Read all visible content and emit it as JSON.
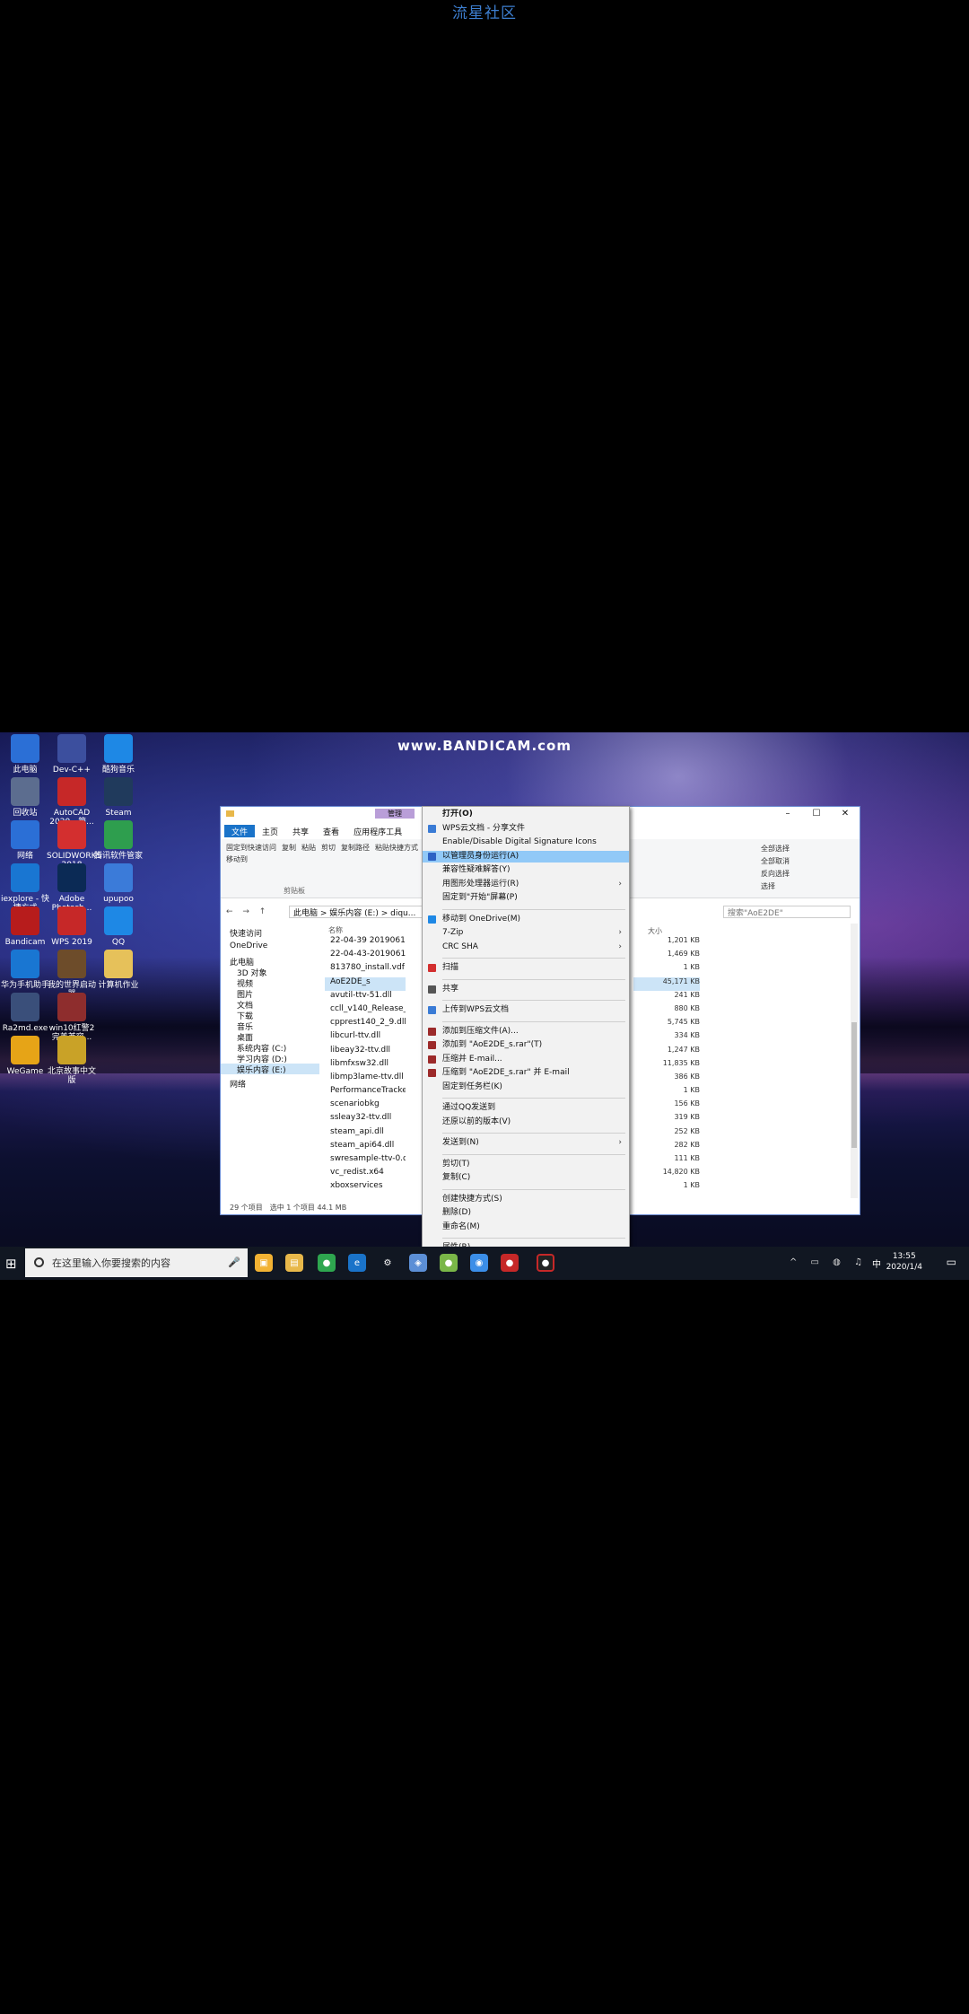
{
  "page_title": "流星社区",
  "watermark": "www.BANDICAM.com",
  "desktop_icons": [
    {
      "label": "此电脑",
      "color": "#2b6fd6"
    },
    {
      "label": "Dev-C++",
      "color": "#3c4f9e"
    },
    {
      "label": "酷狗音乐",
      "color": "#1e88e5"
    },
    {
      "label": "回收站",
      "color": "#5c6d8f"
    },
    {
      "label": "AutoCAD 2020 - 简...",
      "color": "#c62828"
    },
    {
      "label": "Steam",
      "color": "#203a5c"
    },
    {
      "label": "网络",
      "color": "#2b6fd6"
    },
    {
      "label": "SOLIDWORKS 2018",
      "color": "#d32f2f"
    },
    {
      "label": "腾讯软件管家",
      "color": "#2e9e4e"
    },
    {
      "label": "iexplore - 快捷方式",
      "color": "#1976d2"
    },
    {
      "label": "Adobe Photosh...",
      "color": "#0b2a55"
    },
    {
      "label": "upupoo",
      "color": "#3b7bd9"
    },
    {
      "label": "Bandicam",
      "color": "#b71c1c"
    },
    {
      "label": "WPS 2019",
      "color": "#c62828"
    },
    {
      "label": "QQ",
      "color": "#1e88e5"
    },
    {
      "label": "华为手机助手",
      "color": "#1976d2"
    },
    {
      "label": "我的世界启动器",
      "color": "#6d4c2a"
    },
    {
      "label": "计算机作业",
      "color": "#e6c15a"
    },
    {
      "label": "Ra2md.exe",
      "color": "#3a4f7a"
    },
    {
      "label": "win10红警2完美兼容...",
      "color": "#8e2d2d"
    },
    {
      "label": "WeGame",
      "color": "#e6a417"
    },
    {
      "label": "北京故事中文版",
      "color": "#c9a227"
    }
  ],
  "explorer": {
    "context_tab": "管理",
    "tabs": [
      "文件",
      "主页",
      "共享",
      "查看",
      "应用程序工具"
    ],
    "ribbon_group": "剪贴板",
    "ribbon_buttons": [
      "固定到快速访问",
      "复制",
      "粘贴",
      "剪切",
      "复制路径",
      "粘贴快捷方式",
      "移动到",
      "全部选择",
      "全部取消",
      "反向选择",
      "选择"
    ],
    "nav_arrows": "← → ↑",
    "address": "此电脑 > 娱乐内容 (E:) > diqu...",
    "search_placeholder": "搜索\"AoE2DE\"",
    "nav_items": [
      {
        "label": "快速访问",
        "head": true
      },
      {
        "label": "OneDrive",
        "head": true
      },
      {
        "label": "此电脑",
        "head": true
      },
      {
        "label": "3D 对象"
      },
      {
        "label": "视频"
      },
      {
        "label": "图片"
      },
      {
        "label": "文档"
      },
      {
        "label": "下载"
      },
      {
        "label": "音乐"
      },
      {
        "label": "桌面"
      },
      {
        "label": "系统内容 (C:)"
      },
      {
        "label": "学习内容 (D:)"
      },
      {
        "label": "娱乐内容 (E:)",
        "sel": true
      },
      {
        "label": "网络",
        "head": true
      }
    ],
    "name_header": "名称",
    "size_header": "大小",
    "files": [
      {
        "name": "22-04-39 201906115",
        "size": "1,201 KB"
      },
      {
        "name": "22-04-43-201906115",
        "size": "1,469 KB"
      },
      {
        "name": "813780_install.vdf",
        "size": "1 KB"
      },
      {
        "name": "AoE2DE_s",
        "size": "45,171 KB",
        "sel": true
      },
      {
        "name": "avutil-ttv-51.dll",
        "size": "241 KB"
      },
      {
        "name": "ccll_v140_Release_x6",
        "size": "880 KB"
      },
      {
        "name": "cpprest140_2_9.dll",
        "size": "5,745 KB"
      },
      {
        "name": "libcurl-ttv.dll",
        "size": "334 KB"
      },
      {
        "name": "libeay32-ttv.dll",
        "size": "1,247 KB"
      },
      {
        "name": "libmfxsw32.dll",
        "size": "11,835 KB"
      },
      {
        "name": "libmp3lame-ttv.dll",
        "size": "386 KB"
      },
      {
        "name": "PerformanceTracker",
        "size": "1 KB"
      },
      {
        "name": "scenariobkg",
        "size": "156 KB"
      },
      {
        "name": "ssleay32-ttv.dll",
        "size": "319 KB"
      },
      {
        "name": "steam_api.dll",
        "size": "252 KB"
      },
      {
        "name": "steam_api64.dll",
        "size": "282 KB"
      },
      {
        "name": "swresample-ttv-0.dll",
        "size": "111 KB"
      },
      {
        "name": "vc_redist.x64",
        "size": "14,820 KB"
      },
      {
        "name": "xboxservices",
        "size": "1 KB"
      }
    ],
    "status": "29 个项目　选中 1 个项目 44.1 MB"
  },
  "context_menu": {
    "items": [
      {
        "label": "打开(O)",
        "bold": true
      },
      {
        "label": "WPS云文档 - 分享文件",
        "icon": "#3a7bd5"
      },
      {
        "label": "Enable/Disable Digital Signature Icons"
      },
      {
        "label": "以管理员身份运行(A)",
        "icon": "#2d62c4",
        "hl": true
      },
      {
        "label": "兼容性疑难解答(Y)"
      },
      {
        "label": "用图形处理器运行(R)",
        "submenu": true
      },
      {
        "label": "固定到\"开始\"屏幕(P)"
      },
      {
        "label": "移动到 OneDrive(M)",
        "icon": "#1e88e5",
        "sep_before": true
      },
      {
        "label": "7-Zip",
        "submenu": true
      },
      {
        "label": "CRC SHA",
        "submenu": true
      },
      {
        "label": "扫描",
        "icon": "#d32f2f",
        "sep_before": true
      },
      {
        "label": "共享",
        "icon": "#555555",
        "sep_before": true
      },
      {
        "label": "上传到WPS云文档",
        "icon": "#3a7bd5",
        "sep_before": true
      },
      {
        "label": "添加到压缩文件(A)...",
        "icon": "#9c2a2a",
        "sep_before": true
      },
      {
        "label": "添加到 \"AoE2DE_s.rar\"(T)",
        "icon": "#9c2a2a"
      },
      {
        "label": "压缩并 E-mail...",
        "icon": "#9c2a2a"
      },
      {
        "label": "压缩到 \"AoE2DE_s.rar\" 并 E-mail",
        "icon": "#9c2a2a"
      },
      {
        "label": "固定到任务栏(K)"
      },
      {
        "label": "通过QQ发送到",
        "sep_before": true
      },
      {
        "label": "还原以前的版本(V)"
      },
      {
        "label": "发送到(N)",
        "submenu": true,
        "sep_before": true
      },
      {
        "label": "剪切(T)",
        "sep_before": true
      },
      {
        "label": "复制(C)"
      },
      {
        "label": "创建快捷方式(S)",
        "sep_before": true
      },
      {
        "label": "删除(D)"
      },
      {
        "label": "重命名(M)"
      },
      {
        "label": "属性(R)",
        "sep_before": true
      }
    ]
  },
  "taskbar": {
    "search_placeholder": "在这里输入你要搜索的内容",
    "time": "13:55",
    "date": "2020/1/4",
    "tray_text": "中"
  }
}
